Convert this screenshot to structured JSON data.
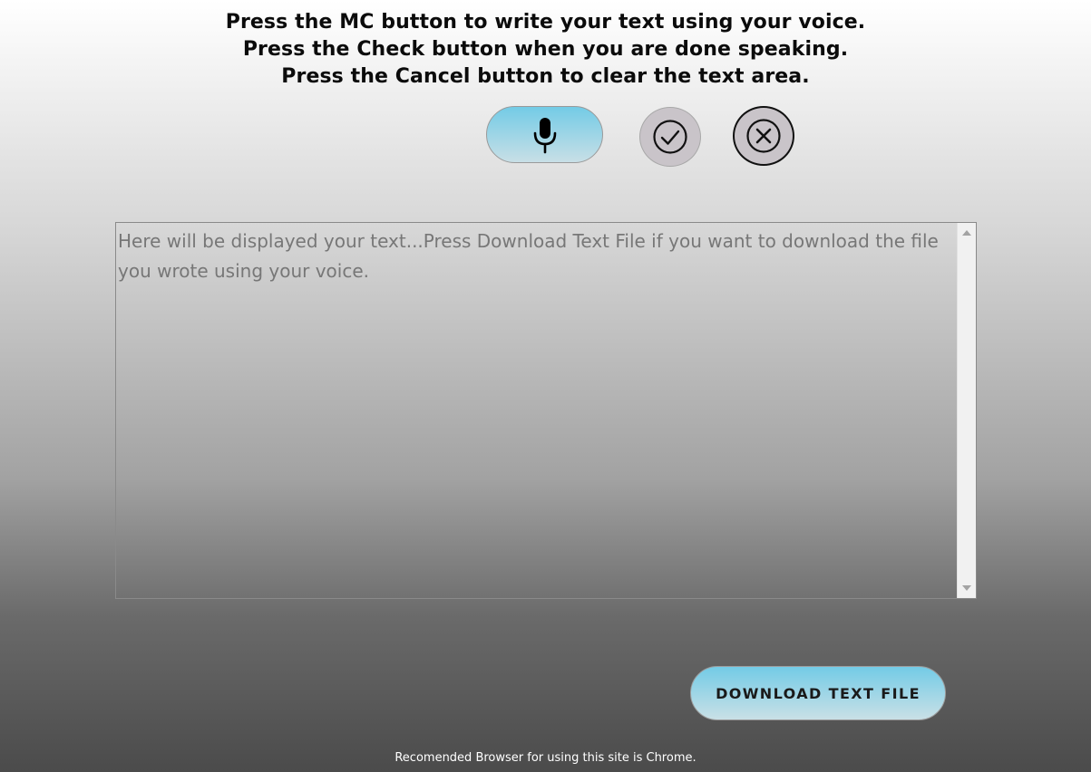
{
  "instructions": {
    "line1": "Press the MC button to write your text using your voice.",
    "line2": "Press the Check button when you are done speaking.",
    "line3": "Press the Cancel button to clear the text area."
  },
  "controls": {
    "mic_icon": "microphone-icon",
    "check_icon": "check-circle-icon",
    "cancel_icon": "x-circle-icon"
  },
  "text_area": {
    "value": "",
    "placeholder": "Here will be displayed your text...Press Download Text File if you want to download the file you wrote using your voice."
  },
  "download": {
    "label": "DOWNLOAD TEXT FILE"
  },
  "footer": {
    "text": "Recomended Browser for using this site is Chrome."
  },
  "colors": {
    "button_gradient_top": "#73cbe6",
    "button_gradient_bottom": "#c9e0e6",
    "round_button_bg": "#c9c4c9"
  }
}
